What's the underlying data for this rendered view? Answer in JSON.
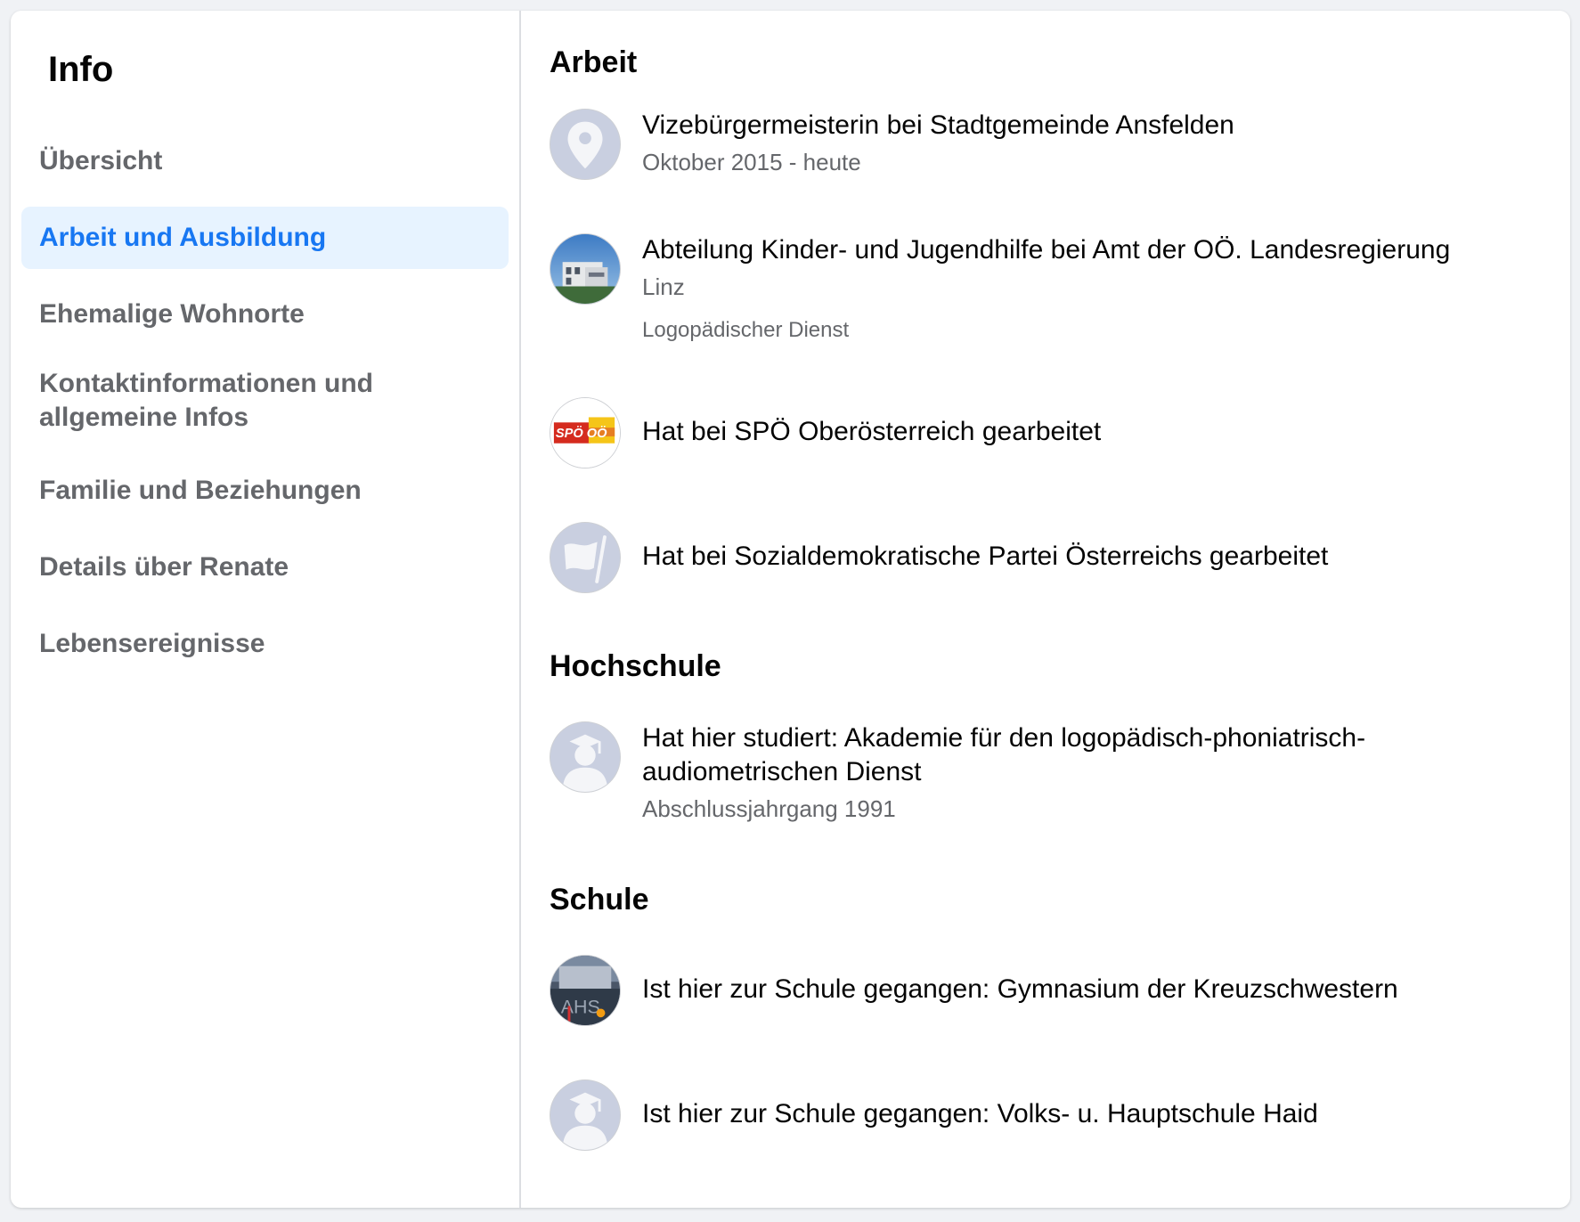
{
  "sidebar": {
    "title": "Info",
    "items": [
      {
        "label": "Übersicht"
      },
      {
        "label": "Arbeit und Ausbildung"
      },
      {
        "label": "Ehemalige Wohnorte"
      },
      {
        "label": "Kontaktinformationen und allgemeine Infos"
      },
      {
        "label": "Familie und Beziehungen"
      },
      {
        "label": "Details über Renate"
      },
      {
        "label": "Lebensereignisse"
      }
    ],
    "active_color": "#1877f2",
    "active_bg": "#e7f3ff"
  },
  "main": {
    "work": {
      "heading": "Arbeit",
      "entries": [
        {
          "title": "Vizebürgermeisterin bei Stadtgemeinde Ansfelden",
          "sub": "Oktober 2015 - heute",
          "icon": "map-pin-icon"
        },
        {
          "title": "Abteilung Kinder- und Jugendhilfe bei Amt der OÖ. Landesregierung",
          "sub": "Linz",
          "extra": "Logopädischer Dienst",
          "icon": "building-photo"
        },
        {
          "title": "Hat bei SPÖ Oberösterreich gearbeitet",
          "icon": "spoe-logo",
          "logo_text": "SPÖ OÖ"
        },
        {
          "title": "Hat bei Sozialdemokratische Partei Österreichs gearbeitet",
          "icon": "flag-icon"
        }
      ]
    },
    "university": {
      "heading": "Hochschule",
      "entries": [
        {
          "title": "Hat hier studiert: Akademie für den logopädisch-phoniatrisch-audiometrischen Dienst",
          "sub": "Abschlussjahrgang 1991",
          "icon": "graduate-icon"
        }
      ]
    },
    "school": {
      "heading": "Schule",
      "entries": [
        {
          "title": "Ist hier zur Schule gegangen: Gymnasium der Kreuzschwestern",
          "icon": "school-photo"
        },
        {
          "title": "Ist hier zur Schule gegangen: Volks- u. Hauptschule Haid",
          "icon": "graduate-icon"
        }
      ]
    }
  }
}
